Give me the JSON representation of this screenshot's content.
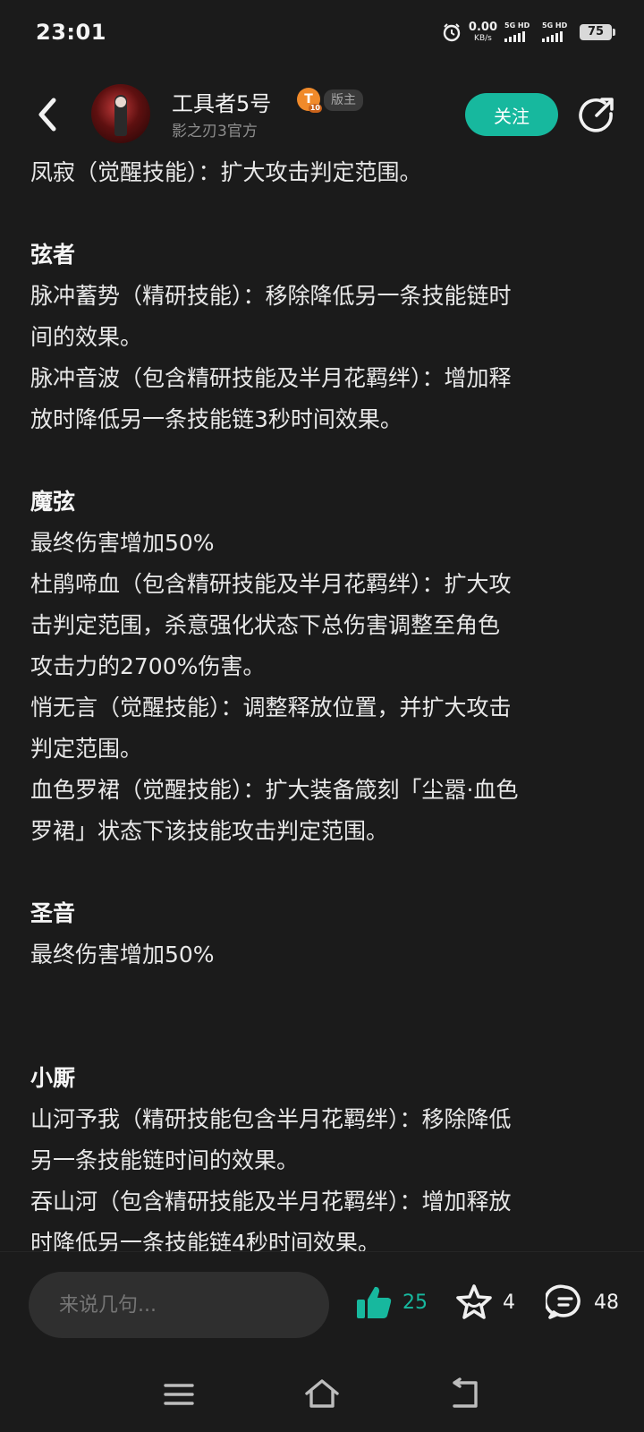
{
  "status_bar": {
    "time": "23:01",
    "net_speed_value": "0.00",
    "net_speed_unit": "KB/s",
    "sim1_label": "5G HD",
    "sim2_label": "5G HD",
    "battery": "75",
    "icons": [
      "alarm-icon",
      "signal-icon",
      "battery-icon"
    ]
  },
  "header": {
    "author_name": "工具者5号",
    "level_badge": "T",
    "level_badge_sub": "10",
    "role_badge": "版主",
    "subtitle": "影之刃3官方",
    "follow_label": "关注",
    "accent": "#17b89e"
  },
  "post": {
    "lines": [
      {
        "type": "text",
        "text": "凤寂（觉醒技能）：扩大攻击判定范围。"
      },
      {
        "type": "gap"
      },
      {
        "type": "heading",
        "text": "弦者"
      },
      {
        "type": "text",
        "text": "脉冲蓄势（精研技能）：移除降低另一条技能链时"
      },
      {
        "type": "text",
        "text": "间的效果。"
      },
      {
        "type": "text",
        "text": "脉冲音波（包含精研技能及半月花羁绊）：增加释"
      },
      {
        "type": "text",
        "text": "放时降低另一条技能链3秒时间效果。"
      },
      {
        "type": "gap"
      },
      {
        "type": "heading",
        "text": "魔弦"
      },
      {
        "type": "text",
        "text": "最终伤害增加50%"
      },
      {
        "type": "text",
        "text": "杜鹃啼血（包含精研技能及半月花羁绊）：扩大攻"
      },
      {
        "type": "text",
        "text": "击判定范围，杀意强化状态下总伤害调整至角色"
      },
      {
        "type": "text",
        "text": "攻击力的2700%伤害。"
      },
      {
        "type": "text",
        "text": "悄无言（觉醒技能）：调整释放位置，并扩大攻击"
      },
      {
        "type": "text",
        "text": "判定范围。"
      },
      {
        "type": "text",
        "text": "血色罗裙（觉醒技能）：扩大装备箴刻「尘嚣·血色"
      },
      {
        "type": "text",
        "text": "罗裙」状态下该技能攻击判定范围。"
      },
      {
        "type": "gap"
      },
      {
        "type": "heading",
        "text": "圣音"
      },
      {
        "type": "text",
        "text": "最终伤害增加50%"
      },
      {
        "type": "gap-lg"
      },
      {
        "type": "heading",
        "text": "小厮"
      },
      {
        "type": "text",
        "text": "山河予我（精研技能包含半月花羁绊）：移除降低"
      },
      {
        "type": "text",
        "text": "另一条技能链时间的效果。"
      },
      {
        "type": "text",
        "text": "吞山河（包含精研技能及半月花羁绊）：增加释放"
      },
      {
        "type": "text",
        "text": "时降低另一条技能链4秒时间效果。"
      }
    ]
  },
  "bottom_bar": {
    "comment_placeholder": "来说几句...",
    "like_count": "25",
    "favorite_count": "4",
    "comment_count": "48"
  }
}
